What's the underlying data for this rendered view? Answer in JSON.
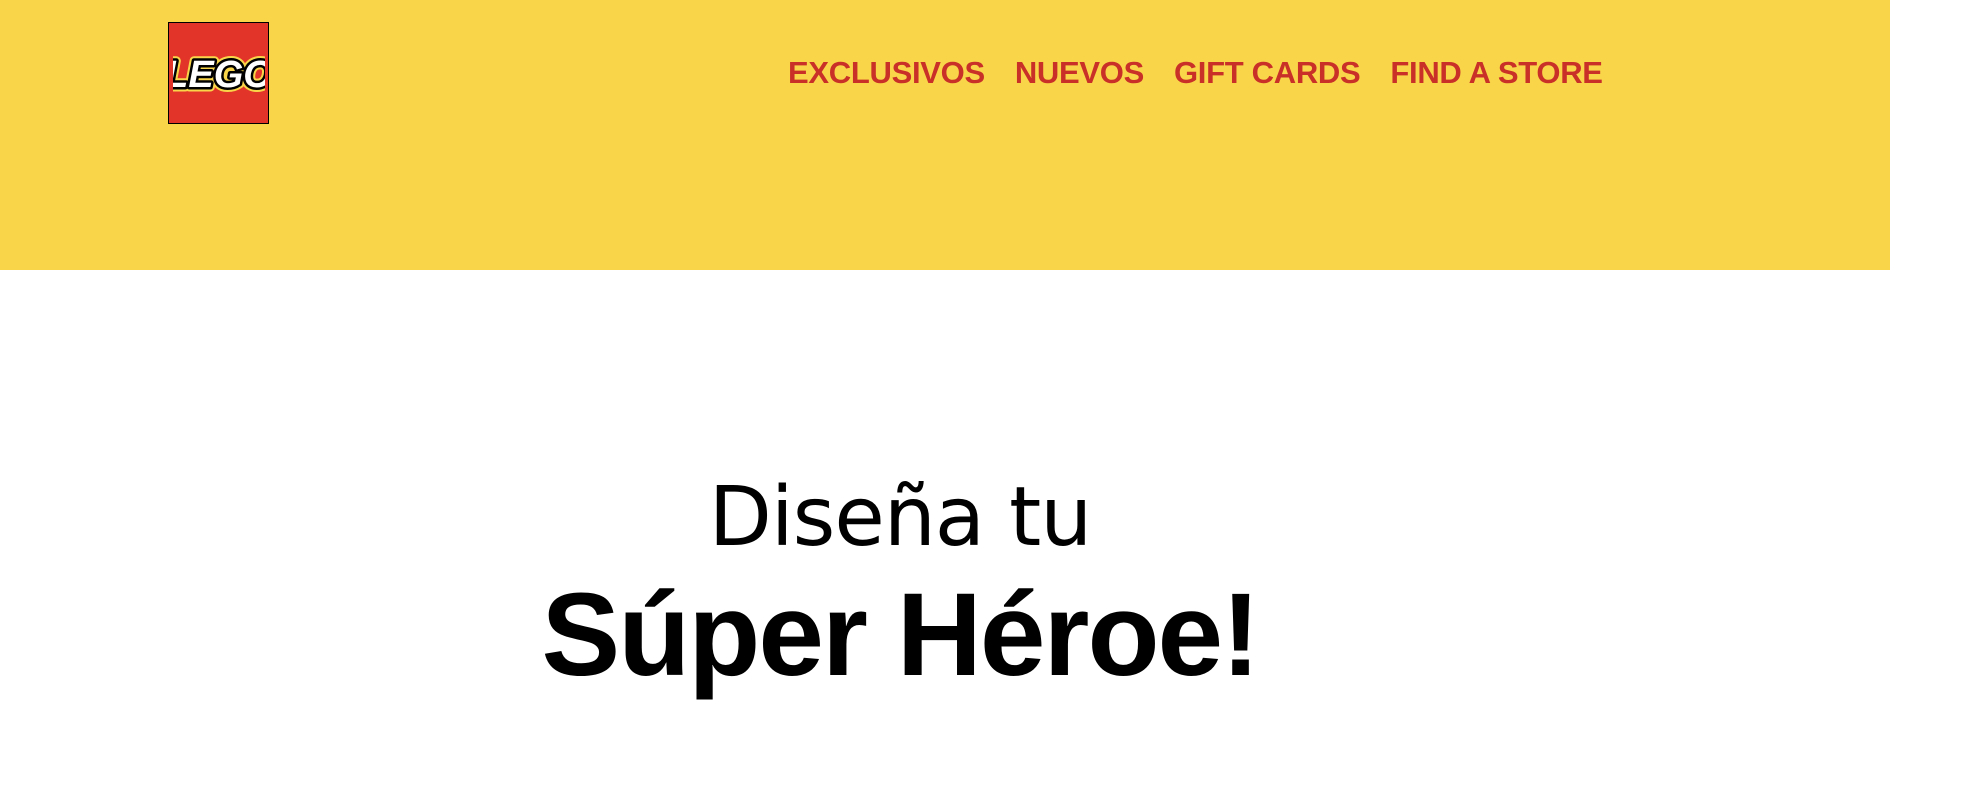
{
  "brand": {
    "logo_text": "LEGO",
    "logo_bg": "#e3342a",
    "header_bg": "#f9d649"
  },
  "nav": {
    "items": [
      {
        "label": "EXCLUSIVOS"
      },
      {
        "label": "NUEVOS"
      },
      {
        "label": "GIFT CARDS"
      },
      {
        "label": "FIND A STORE"
      }
    ],
    "color": "#c93028"
  },
  "hero": {
    "line1": "Diseña tu",
    "line2": "Súper Héroe!"
  }
}
